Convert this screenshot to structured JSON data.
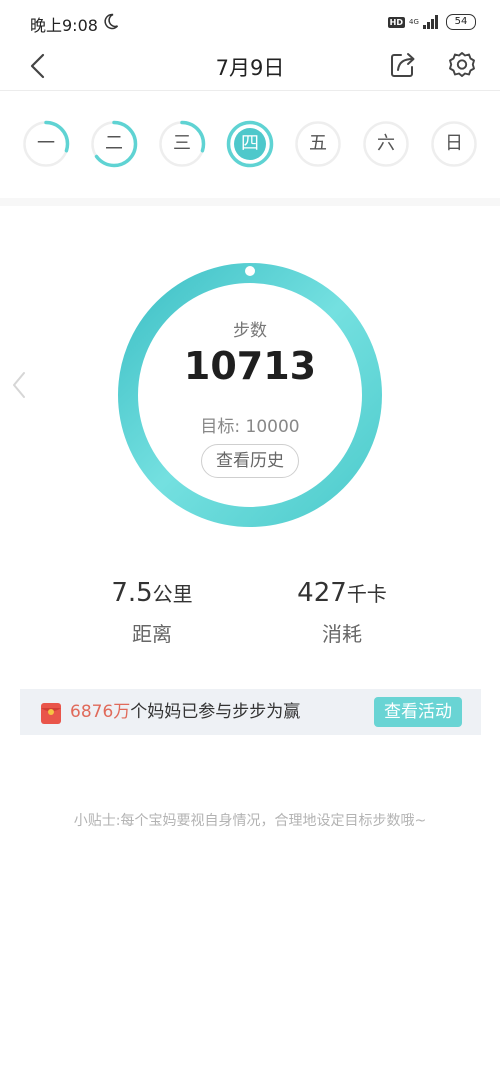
{
  "status_bar": {
    "time": "晚上9:08",
    "hd": "HD",
    "network": "4G",
    "battery": "54"
  },
  "nav": {
    "title": "7月9日"
  },
  "week": {
    "days": [
      {
        "label": "一",
        "progress": 0.3
      },
      {
        "label": "二",
        "progress": 0.65
      },
      {
        "label": "三",
        "progress": 0.3
      },
      {
        "label": "四",
        "progress": 1.0,
        "active": true
      },
      {
        "label": "五",
        "progress": 0
      },
      {
        "label": "六",
        "progress": 0
      },
      {
        "label": "日",
        "progress": 0
      }
    ]
  },
  "ring": {
    "label": "步数",
    "steps": "10713",
    "goal": "目标: 10000",
    "history_button": "查看历史"
  },
  "stats": {
    "distance_value": "7.5",
    "distance_unit": "公里",
    "distance_label": "距离",
    "calories_value": "427",
    "calories_unit": "千卡",
    "calories_label": "消耗"
  },
  "promo": {
    "count": "6876万",
    "text": "个妈妈已参与步步为赢",
    "button": "查看活动"
  },
  "tip": "小贴士:每个宝妈要视自身情况，合理地设定目标步数哦~",
  "colors": {
    "accent": "#5fd3d3",
    "accent_dark": "#3fc1c4",
    "promo_red": "#e06a5a"
  }
}
